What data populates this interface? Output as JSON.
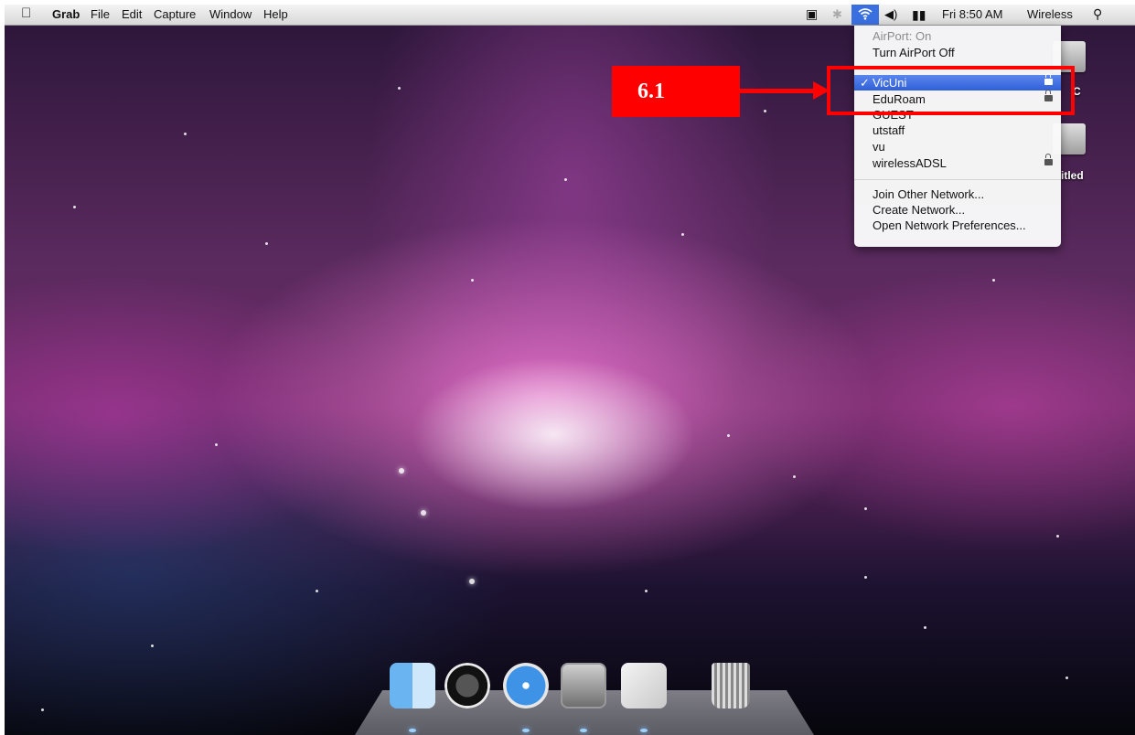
{
  "menubar": {
    "app_name": "Grab",
    "menus": [
      "File",
      "Edit",
      "Capture",
      "Window",
      "Help"
    ],
    "clock": "Fri 8:50 AM",
    "network_label": "Wireless"
  },
  "airport_menu": {
    "status": "AirPort: On",
    "toggle": "Turn AirPort Off",
    "networks": [
      {
        "name": "VicUni",
        "selected": true,
        "locked": true
      },
      {
        "name": "EduRoam",
        "selected": false,
        "locked": true
      },
      {
        "name": "GUEST",
        "selected": false,
        "locked": false
      },
      {
        "name": "utstaff",
        "selected": false,
        "locked": false
      },
      {
        "name": "vu",
        "selected": false,
        "locked": false
      },
      {
        "name": "wirelessADSL",
        "selected": false,
        "locked": true
      }
    ],
    "actions": [
      "Join Other Network...",
      "Create Network...",
      "Open Network Preferences..."
    ],
    "check_mark": "✓"
  },
  "annotation": {
    "label": "6.1",
    "color": "#ff0000"
  },
  "desktop": {
    "drive_labels": [
      "C",
      "itled"
    ]
  },
  "dock": {
    "items": [
      "finder-icon",
      "dashboard-icon",
      "safari-icon",
      "system-preferences-icon",
      "grab-icon",
      "trash-icon"
    ]
  },
  "colors": {
    "selection": "#2f60d8",
    "menubar": "#e6e6e6"
  }
}
